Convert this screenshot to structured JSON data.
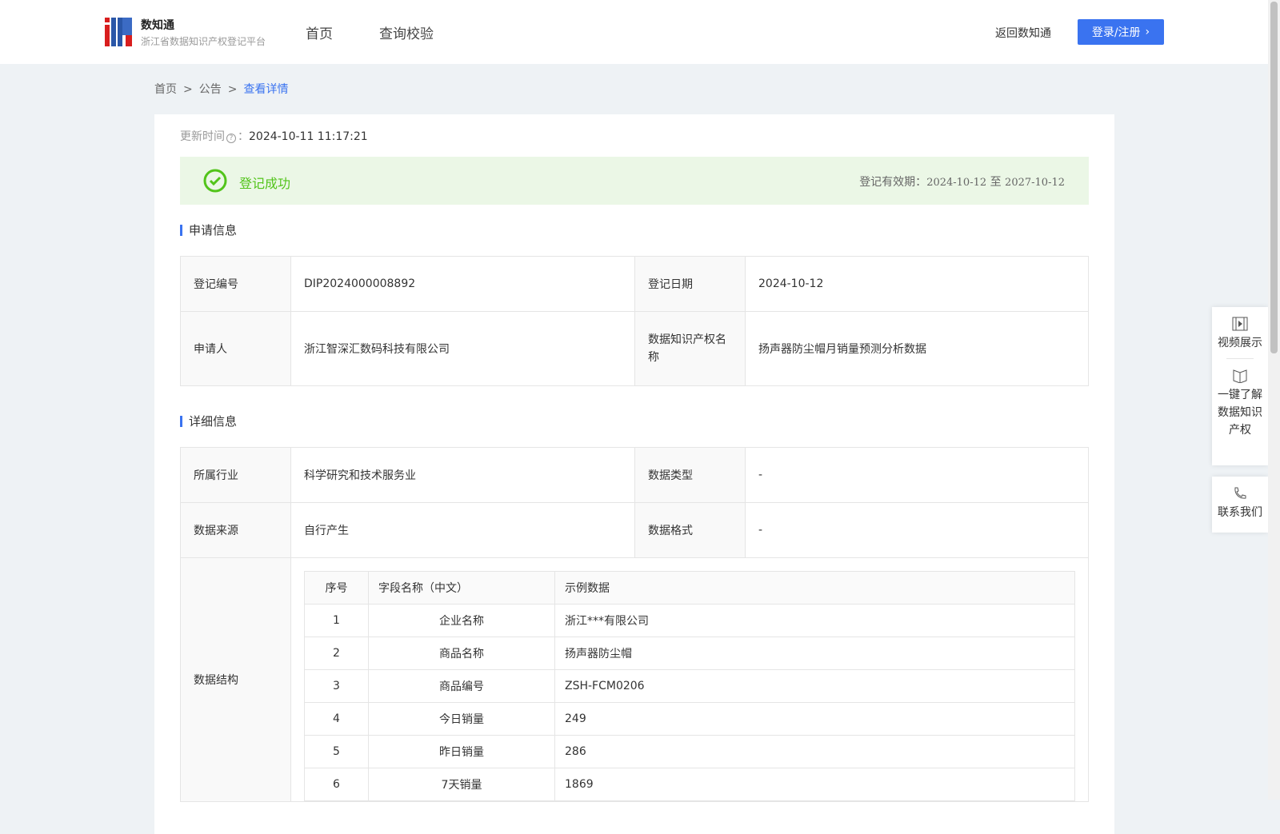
{
  "header": {
    "brand": "数知通",
    "subtitle": "浙江省数据知识产权登记平台",
    "nav": [
      "首页",
      "查询校验"
    ],
    "back": "返回数知通",
    "login": "登录/注册"
  },
  "breadcrumb": [
    "首页",
    "公告",
    "查看详情"
  ],
  "update": {
    "label": "更新时间",
    "value": "2024-10-11 11:17:21"
  },
  "status": {
    "text": "登记成功",
    "valid_label": "登记有效期：",
    "valid_from": "2024-10-12",
    "valid_to_sep": "至",
    "valid_to": "2027-10-12"
  },
  "sections": {
    "apply": "申请信息",
    "detail": "详细信息"
  },
  "apply": {
    "reg_no_label": "登记编号",
    "reg_no": "DIP2024000008892",
    "reg_date_label": "登记日期",
    "reg_date": "2024-10-12",
    "applicant_label": "申请人",
    "applicant": "浙江智深汇数码科技有限公司",
    "name_label": "数据知识产权名称",
    "name": "扬声器防尘帽月销量预测分析数据"
  },
  "detail": {
    "industry_label": "所属行业",
    "industry": "科学研究和技术服务业",
    "type_label": "数据类型",
    "type": "-",
    "source_label": "数据来源",
    "source": "自行产生",
    "format_label": "数据格式",
    "format": "-",
    "structure_label": "数据结构"
  },
  "structure": {
    "headers": [
      "序号",
      "字段名称（中文）",
      "示例数据"
    ],
    "rows": [
      [
        "1",
        "企业名称",
        "浙江***有限公司"
      ],
      [
        "2",
        "商品名称",
        "扬声器防尘帽"
      ],
      [
        "3",
        "商品编号",
        "ZSH-FCM0206"
      ],
      [
        "4",
        "今日销量",
        "249"
      ],
      [
        "5",
        "昨日销量",
        "286"
      ],
      [
        "6",
        "7天销量",
        "1869"
      ]
    ]
  },
  "float": {
    "video": "视频展示",
    "learn": "一键了解数据知识产权",
    "contact": "联系我们"
  }
}
